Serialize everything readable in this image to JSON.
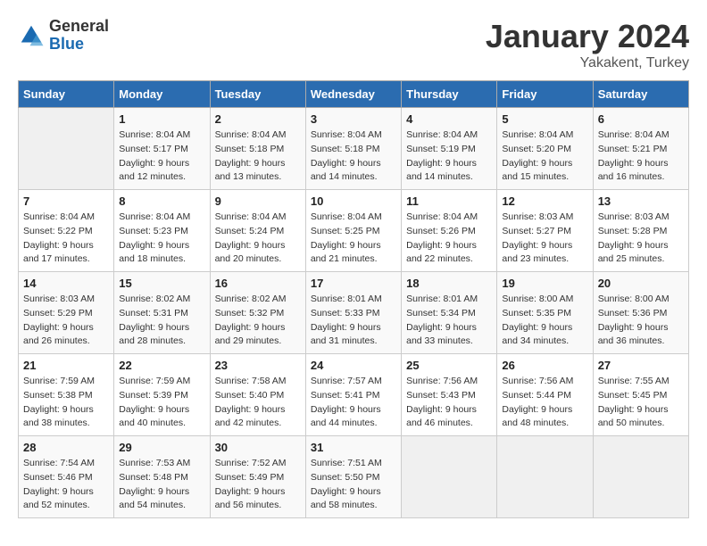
{
  "logo": {
    "general": "General",
    "blue": "Blue"
  },
  "title": "January 2024",
  "location": "Yakakent, Turkey",
  "days_of_week": [
    "Sunday",
    "Monday",
    "Tuesday",
    "Wednesday",
    "Thursday",
    "Friday",
    "Saturday"
  ],
  "weeks": [
    [
      {
        "day": "",
        "empty": true
      },
      {
        "day": "1",
        "sunrise": "Sunrise: 8:04 AM",
        "sunset": "Sunset: 5:17 PM",
        "daylight": "Daylight: 9 hours and 12 minutes."
      },
      {
        "day": "2",
        "sunrise": "Sunrise: 8:04 AM",
        "sunset": "Sunset: 5:18 PM",
        "daylight": "Daylight: 9 hours and 13 minutes."
      },
      {
        "day": "3",
        "sunrise": "Sunrise: 8:04 AM",
        "sunset": "Sunset: 5:18 PM",
        "daylight": "Daylight: 9 hours and 14 minutes."
      },
      {
        "day": "4",
        "sunrise": "Sunrise: 8:04 AM",
        "sunset": "Sunset: 5:19 PM",
        "daylight": "Daylight: 9 hours and 14 minutes."
      },
      {
        "day": "5",
        "sunrise": "Sunrise: 8:04 AM",
        "sunset": "Sunset: 5:20 PM",
        "daylight": "Daylight: 9 hours and 15 minutes."
      },
      {
        "day": "6",
        "sunrise": "Sunrise: 8:04 AM",
        "sunset": "Sunset: 5:21 PM",
        "daylight": "Daylight: 9 hours and 16 minutes."
      }
    ],
    [
      {
        "day": "7",
        "sunrise": "Sunrise: 8:04 AM",
        "sunset": "Sunset: 5:22 PM",
        "daylight": "Daylight: 9 hours and 17 minutes."
      },
      {
        "day": "8",
        "sunrise": "Sunrise: 8:04 AM",
        "sunset": "Sunset: 5:23 PM",
        "daylight": "Daylight: 9 hours and 18 minutes."
      },
      {
        "day": "9",
        "sunrise": "Sunrise: 8:04 AM",
        "sunset": "Sunset: 5:24 PM",
        "daylight": "Daylight: 9 hours and 20 minutes."
      },
      {
        "day": "10",
        "sunrise": "Sunrise: 8:04 AM",
        "sunset": "Sunset: 5:25 PM",
        "daylight": "Daylight: 9 hours and 21 minutes."
      },
      {
        "day": "11",
        "sunrise": "Sunrise: 8:04 AM",
        "sunset": "Sunset: 5:26 PM",
        "daylight": "Daylight: 9 hours and 22 minutes."
      },
      {
        "day": "12",
        "sunrise": "Sunrise: 8:03 AM",
        "sunset": "Sunset: 5:27 PM",
        "daylight": "Daylight: 9 hours and 23 minutes."
      },
      {
        "day": "13",
        "sunrise": "Sunrise: 8:03 AM",
        "sunset": "Sunset: 5:28 PM",
        "daylight": "Daylight: 9 hours and 25 minutes."
      }
    ],
    [
      {
        "day": "14",
        "sunrise": "Sunrise: 8:03 AM",
        "sunset": "Sunset: 5:29 PM",
        "daylight": "Daylight: 9 hours and 26 minutes."
      },
      {
        "day": "15",
        "sunrise": "Sunrise: 8:02 AM",
        "sunset": "Sunset: 5:31 PM",
        "daylight": "Daylight: 9 hours and 28 minutes."
      },
      {
        "day": "16",
        "sunrise": "Sunrise: 8:02 AM",
        "sunset": "Sunset: 5:32 PM",
        "daylight": "Daylight: 9 hours and 29 minutes."
      },
      {
        "day": "17",
        "sunrise": "Sunrise: 8:01 AM",
        "sunset": "Sunset: 5:33 PM",
        "daylight": "Daylight: 9 hours and 31 minutes."
      },
      {
        "day": "18",
        "sunrise": "Sunrise: 8:01 AM",
        "sunset": "Sunset: 5:34 PM",
        "daylight": "Daylight: 9 hours and 33 minutes."
      },
      {
        "day": "19",
        "sunrise": "Sunrise: 8:00 AM",
        "sunset": "Sunset: 5:35 PM",
        "daylight": "Daylight: 9 hours and 34 minutes."
      },
      {
        "day": "20",
        "sunrise": "Sunrise: 8:00 AM",
        "sunset": "Sunset: 5:36 PM",
        "daylight": "Daylight: 9 hours and 36 minutes."
      }
    ],
    [
      {
        "day": "21",
        "sunrise": "Sunrise: 7:59 AM",
        "sunset": "Sunset: 5:38 PM",
        "daylight": "Daylight: 9 hours and 38 minutes."
      },
      {
        "day": "22",
        "sunrise": "Sunrise: 7:59 AM",
        "sunset": "Sunset: 5:39 PM",
        "daylight": "Daylight: 9 hours and 40 minutes."
      },
      {
        "day": "23",
        "sunrise": "Sunrise: 7:58 AM",
        "sunset": "Sunset: 5:40 PM",
        "daylight": "Daylight: 9 hours and 42 minutes."
      },
      {
        "day": "24",
        "sunrise": "Sunrise: 7:57 AM",
        "sunset": "Sunset: 5:41 PM",
        "daylight": "Daylight: 9 hours and 44 minutes."
      },
      {
        "day": "25",
        "sunrise": "Sunrise: 7:56 AM",
        "sunset": "Sunset: 5:43 PM",
        "daylight": "Daylight: 9 hours and 46 minutes."
      },
      {
        "day": "26",
        "sunrise": "Sunrise: 7:56 AM",
        "sunset": "Sunset: 5:44 PM",
        "daylight": "Daylight: 9 hours and 48 minutes."
      },
      {
        "day": "27",
        "sunrise": "Sunrise: 7:55 AM",
        "sunset": "Sunset: 5:45 PM",
        "daylight": "Daylight: 9 hours and 50 minutes."
      }
    ],
    [
      {
        "day": "28",
        "sunrise": "Sunrise: 7:54 AM",
        "sunset": "Sunset: 5:46 PM",
        "daylight": "Daylight: 9 hours and 52 minutes."
      },
      {
        "day": "29",
        "sunrise": "Sunrise: 7:53 AM",
        "sunset": "Sunset: 5:48 PM",
        "daylight": "Daylight: 9 hours and 54 minutes."
      },
      {
        "day": "30",
        "sunrise": "Sunrise: 7:52 AM",
        "sunset": "Sunset: 5:49 PM",
        "daylight": "Daylight: 9 hours and 56 minutes."
      },
      {
        "day": "31",
        "sunrise": "Sunrise: 7:51 AM",
        "sunset": "Sunset: 5:50 PM",
        "daylight": "Daylight: 9 hours and 58 minutes."
      },
      {
        "day": "",
        "empty": true
      },
      {
        "day": "",
        "empty": true
      },
      {
        "day": "",
        "empty": true
      }
    ]
  ]
}
